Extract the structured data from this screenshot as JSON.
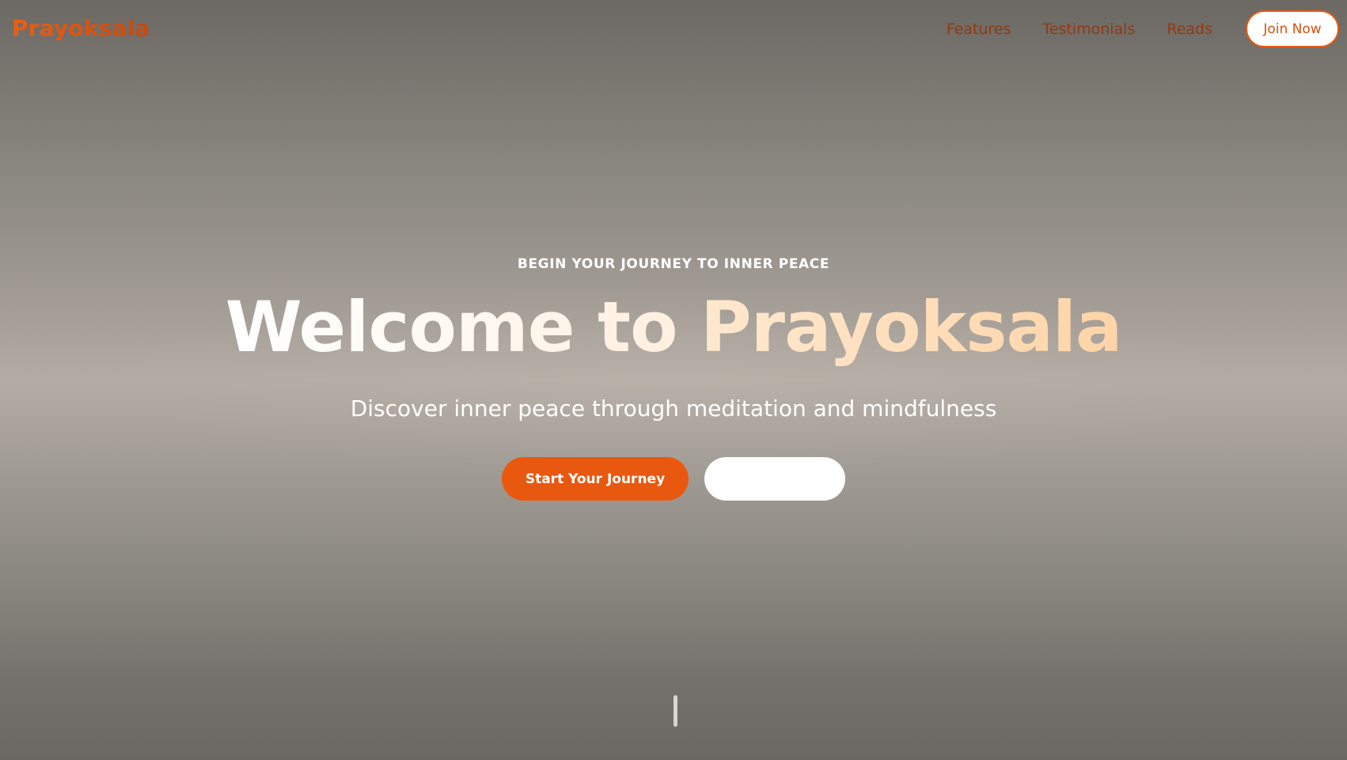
{
  "brand": {
    "logo_text": "Prayoksala",
    "accent_color": "#e9580f"
  },
  "nav": {
    "links": [
      {
        "label": "Features"
      },
      {
        "label": "Testimonials"
      },
      {
        "label": "Reads"
      }
    ],
    "join_label": "Join Now"
  },
  "hero": {
    "eyebrow": "BEGIN YOUR JOURNEY TO INNER PEACE",
    "title_prefix": "Welcome to ",
    "title_brand": "Prayoksala",
    "subtitle": "Discover inner peace through meditation and mindfulness",
    "primary_cta": "Start Your Journey",
    "secondary_cta": ""
  },
  "icons": {
    "scroll_indicator": "scroll-indicator-icon"
  }
}
